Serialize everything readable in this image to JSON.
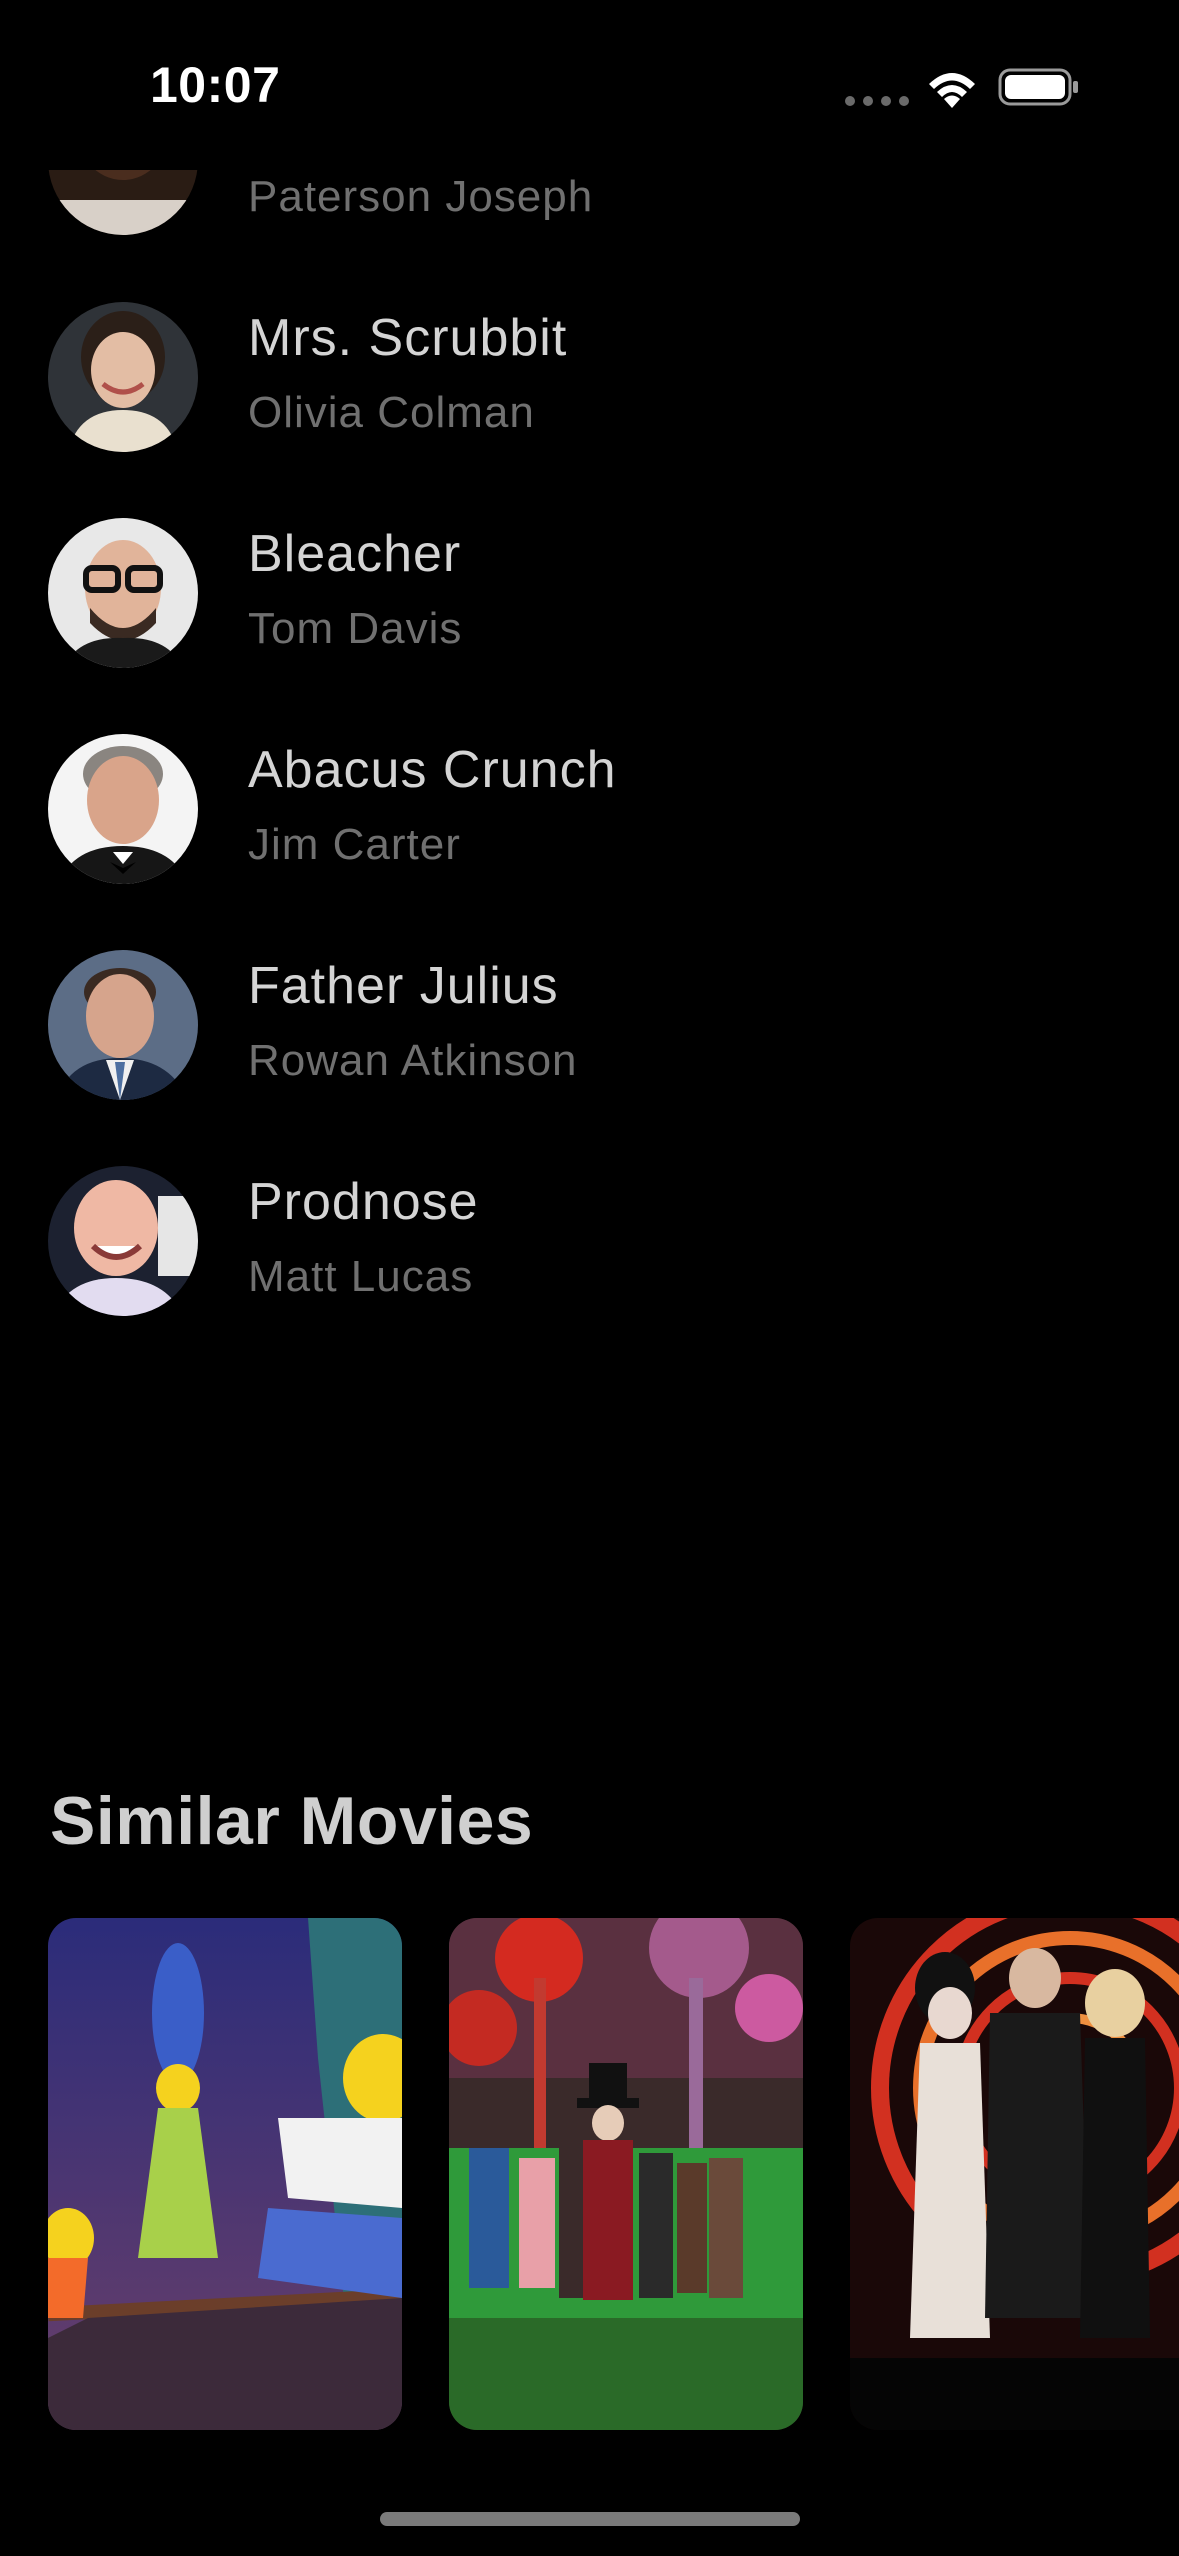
{
  "status_bar": {
    "time": "10:07"
  },
  "cast": [
    {
      "character": "",
      "actor": "Paterson Joseph",
      "avatar_icon": "person-avatar"
    },
    {
      "character": "Mrs. Scrubbit",
      "actor": "Olivia Colman",
      "avatar_icon": "person-avatar"
    },
    {
      "character": "Bleacher",
      "actor": "Tom Davis",
      "avatar_icon": "person-avatar"
    },
    {
      "character": "Abacus Crunch",
      "actor": "Jim Carter",
      "avatar_icon": "person-avatar"
    },
    {
      "character": "Father Julius",
      "actor": "Rowan Atkinson",
      "avatar_icon": "person-avatar"
    },
    {
      "character": "Prodnose",
      "actor": "Matt Lucas",
      "avatar_icon": "person-avatar"
    }
  ],
  "similar_movies": {
    "title": "Similar Movies",
    "items": [
      {
        "poster_icon": "movie-poster-cartoon"
      },
      {
        "poster_icon": "movie-poster-chocolate-factory"
      },
      {
        "poster_icon": "movie-poster-musical"
      }
    ]
  },
  "colors": {
    "background": "#000000",
    "primary_text": "#d4d4d4",
    "secondary_text": "#707070"
  }
}
